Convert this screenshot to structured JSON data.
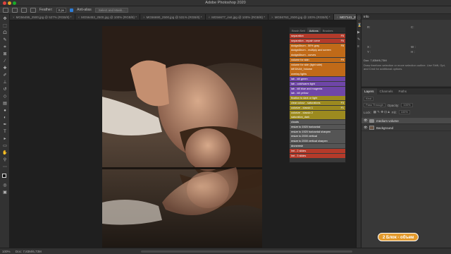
{
  "app": {
    "title": "Adobe Photoshop 2020"
  },
  "options_bar": {
    "feather_label": "Feather:",
    "feather_value": "0 px",
    "anti_alias_label": "Anti-alias",
    "select_mask_label": "Select and Mask..."
  },
  "tabs": [
    {
      "label": "MG56495_2500.jpg @ 527% (RGB/8) *",
      "active": false
    },
    {
      "label": "MG56453_2500.jpg @ 100% (RGB/8) *",
      "active": false
    },
    {
      "label": "MG56690_2500.jpg @ 531% (RGB/8) *",
      "active": false
    },
    {
      "label": "MG56677_inst.jpg @ 100% (RGB/8) *",
      "active": false
    },
    {
      "label": "MG56763_2500.jpg @ 100% (RGB/8) *",
      "active": false
    },
    {
      "label": "MG7141_2500.jpg @ 100% (medium volume, RGB/8) *",
      "active": true
    }
  ],
  "actions_panel": {
    "tabs": [
      "Brush Sett",
      "Actions",
      "Brushes"
    ],
    "active_tab": "Actions",
    "items": [
      {
        "label": "separation",
        "key": "F5",
        "color": "#b43a2a"
      },
      {
        "label": "separation - repair curve",
        "key": "F6",
        "color": "#b43a2a"
      },
      {
        "label": "dodge&burn - 50% gray",
        "key": "F8",
        "color": "#c06a18"
      },
      {
        "label": "dodge&burn - multiply and screen",
        "key": "",
        "color": "#c06a18"
      },
      {
        "label": "dodge&burn - curves",
        "key": "",
        "color": "#c06a18"
      },
      {
        "label": "volume for skin",
        "key": "F9",
        "color": "#c06a18"
      },
      {
        "label": "volume for skin (light side)",
        "key": "",
        "color": "#c06a18"
      },
      {
        "label": "MEDIUM_Volume",
        "key": "",
        "color": "#c06a18"
      },
      {
        "label": "overlay lights",
        "key": "",
        "color": "#c06a18"
      },
      {
        "label": "lab - kill green",
        "key": "",
        "color": "#6f46a8"
      },
      {
        "label": "lab - cold/warm light",
        "key": "",
        "color": "#6f46a8"
      },
      {
        "label": "lab - kill blue and magenta",
        "key": "",
        "color": "#6f46a8"
      },
      {
        "label": "lab - kill yellow",
        "key": "",
        "color": "#6f46a8"
      },
      {
        "label": "fixation to dark or light",
        "key": "",
        "color": "#9c8a1f"
      },
      {
        "label": "clear colour - saturations",
        "key": "F3",
        "color": "#9c8a1f"
      },
      {
        "label": "colorize - classic 1",
        "key": "F1",
        "color": "#9c8a1f"
      },
      {
        "label": "colorize - classic 2",
        "key": "",
        "color": "#9c8a1f"
      },
      {
        "label": "saturation_dark",
        "key": "",
        "color": "#9c8a1f"
      },
      {
        "label": "clouds",
        "key": "",
        "color": "#555555"
      },
      {
        "label": "resize to 1920 horizontal",
        "key": "",
        "color": "#555555"
      },
      {
        "label": "resize to 1920 horizontal sharpen",
        "key": "",
        "color": "#555555"
      },
      {
        "label": "resize to 2000 vertical",
        "key": "",
        "color": "#555555"
      },
      {
        "label": "resize to 2000 vertical sharpen",
        "key": "",
        "color": "#555555"
      },
      {
        "label": "droneresh",
        "key": "",
        "color": "#555555"
      },
      {
        "label": "lmt - 2 slides",
        "key": "",
        "color": "#b43a2a"
      },
      {
        "label": "lmt - 3 slides",
        "key": "",
        "color": "#b43a2a"
      }
    ]
  },
  "info_panel": {
    "title": "Info",
    "x_label": "X :",
    "y_label": "Y :",
    "w_label": "W :",
    "h_label": "H :",
    "doc_line": "Doc: 7,83M/6,73M",
    "hint": "Draw freeform selection or move selection outline. Use Shift, Opt, and Cmd for additional options."
  },
  "layers_panel": {
    "tabs": [
      "Layers",
      "Channels",
      "Paths"
    ],
    "active_tab": "Layers",
    "kind_label": "Kind",
    "blend_mode": "Pass Through",
    "opacity_label": "Opacity:",
    "opacity_value": "100%",
    "lock_label": "Lock:",
    "fill_label": "Fill:",
    "fill_value": "100%",
    "layers": [
      {
        "name": "medium volume",
        "selected": true,
        "type": "group"
      },
      {
        "name": "Background",
        "selected": false,
        "type": "image"
      }
    ]
  },
  "status": {
    "zoom": "100%",
    "doc": "Doc: 7,83M/6,73M"
  },
  "watermark": {
    "text": "2 Блок - объем"
  }
}
